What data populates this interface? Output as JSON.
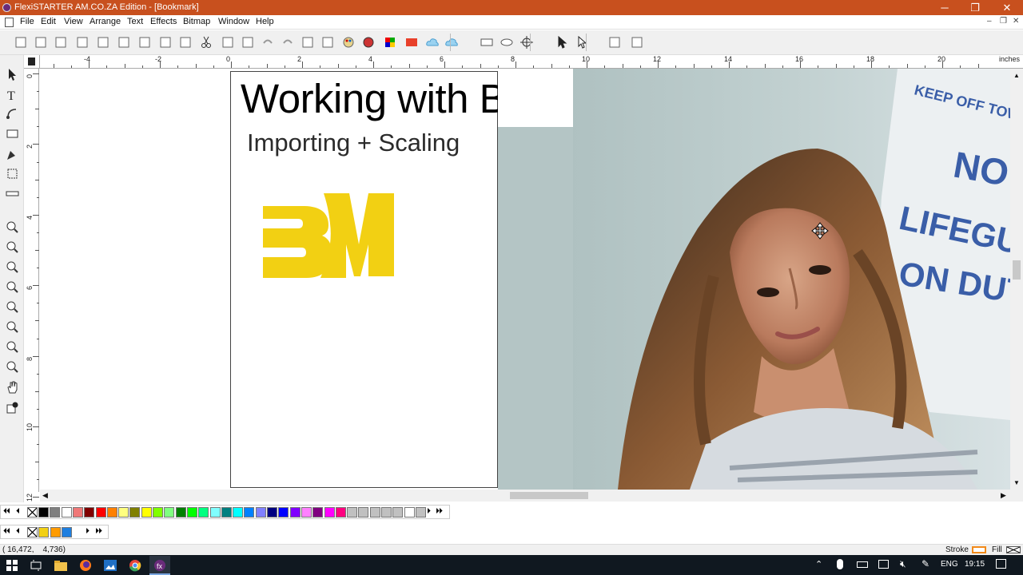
{
  "window": {
    "title": "FlexiSTARTER AM.CO.ZA Edition - [Bookmark]",
    "controls": {
      "minimize": "─",
      "restore": "❐",
      "close": "✕"
    }
  },
  "menu": {
    "items": [
      "File",
      "Edit",
      "View",
      "Arrange",
      "Text",
      "Effects",
      "Bitmap",
      "Window",
      "Help"
    ],
    "doc_controls": {
      "minimize": "–",
      "restore": "❐",
      "close": "✕"
    }
  },
  "toolbar": {
    "icons": [
      "new-icon",
      "open-icon",
      "save-icon",
      "save-as-icon",
      "import-icon",
      "export-icon",
      "print-icon",
      "send-to-cut-icon",
      "send-to-output-icon",
      "cut-icon",
      "copy-icon",
      "paste-icon",
      "undo-icon",
      "redo-icon",
      "properties-icon",
      "color-picker-icon",
      "palette-icon",
      "color-wheel-icon",
      "registration-icon",
      "er-icon",
      "cloud-icon",
      "cloud-upload-icon",
      "rectangle-icon",
      "ellipse-icon",
      "point-icon",
      "select-icon",
      "node-select-icon",
      "knife-icon",
      "weld-icon"
    ]
  },
  "ruler": {
    "unit": "inches",
    "top_labels": [
      "-4",
      "-2",
      "0",
      "2",
      "4",
      "6",
      "8",
      "10",
      "12",
      "14",
      "16",
      "18",
      "20"
    ],
    "left_labels": [
      "0",
      "2",
      "4",
      "6",
      "8",
      "10",
      "12"
    ]
  },
  "left_tools": [
    "select-tool-icon",
    "text-tool-icon",
    "shape-tool-icon",
    "rectangle-tool-icon",
    "pen-tool-icon",
    "transform-tool-icon",
    "measure-tool-icon",
    "zoom-tool-icon",
    "zoom-in-icon",
    "zoom-area-icon",
    "zoom-out-icon",
    "zoom-page-icon",
    "zoom-selection-icon",
    "zoom-all-icon",
    "zoom-previous-icon",
    "pan-icon",
    "fill-tool-icon"
  ],
  "canvas": {
    "heading": "Working with Bitm",
    "subheading": "Importing + Scaling",
    "logo_text": "BM",
    "logo_color": "#f2d013",
    "photo": {
      "sign_lines": [
        "KEEP OFF TOW",
        "NO",
        "LIFEGUARD",
        "ON DUTY"
      ],
      "sign_color": "#3a5ea8"
    }
  },
  "palette": {
    "colors": [
      "#000000",
      "#7f7f7f",
      "#ffffff",
      "#f07878",
      "#800000",
      "#ff0000",
      "#ff8000",
      "#ffff80",
      "#808000",
      "#ffff00",
      "#80ff00",
      "#80ff80",
      "#008000",
      "#00ff00",
      "#00ff80",
      "#80ffff",
      "#008080",
      "#00ffff",
      "#0080ff",
      "#8080ff",
      "#000080",
      "#0000ff",
      "#8000ff",
      "#ff80ff",
      "#800080",
      "#ff00ff",
      "#ff0080",
      "#c0c0c0",
      "#c0c0c0",
      "#c0c0c0",
      "#c0c0c0",
      "#c0c0c0",
      "#ffffff",
      "#c0c0c0"
    ],
    "doc_colors": [
      "#f2d013",
      "#ff9b00",
      "#1e7fe0"
    ],
    "nav_first": "⏴⏴",
    "nav_prev": "⏴",
    "nav_next": "⏵",
    "nav_last": "⏵⏵"
  },
  "status": {
    "coordinates": "( 16,472,    4,736)",
    "stroke_label": "Stroke",
    "fill_label": "Fill"
  },
  "taskbar": {
    "language": "ENG",
    "time": "19:15"
  }
}
